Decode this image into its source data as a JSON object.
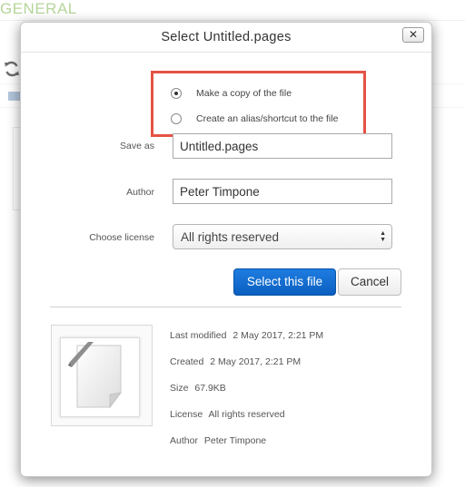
{
  "background": {
    "brand_text": "GENERAL"
  },
  "dialog": {
    "title": "Select Untitled.pages",
    "close_glyph": "✕",
    "options": [
      {
        "label": "Make a copy of the file",
        "checked": true
      },
      {
        "label": "Create an alias/shortcut to the file",
        "checked": false
      }
    ],
    "save_as": {
      "label": "Save as",
      "value": "Untitled.pages"
    },
    "author": {
      "label": "Author",
      "value": "Peter Timpone"
    },
    "license": {
      "label": "Choose license",
      "selected": "All rights reserved"
    },
    "buttons": {
      "select": "Select this file",
      "cancel": "Cancel"
    },
    "file_info": {
      "last_modified_label": "Last modified",
      "last_modified_value": "2 May 2017, 2:21 PM",
      "created_label": "Created",
      "created_value": "2 May 2017, 2:21 PM",
      "size_label": "Size",
      "size_value": "67.9KB",
      "license_label": "License",
      "license_value": "All rights reserved",
      "author_label": "Author",
      "author_value": "Peter Timpone"
    }
  },
  "colors": {
    "highlight": "#e55244",
    "primary_button": "#1a73d9",
    "brand": "#8fc065"
  },
  "icons": [
    "refresh-icon",
    "folder-icon",
    "close-icon",
    "document-icon"
  ]
}
